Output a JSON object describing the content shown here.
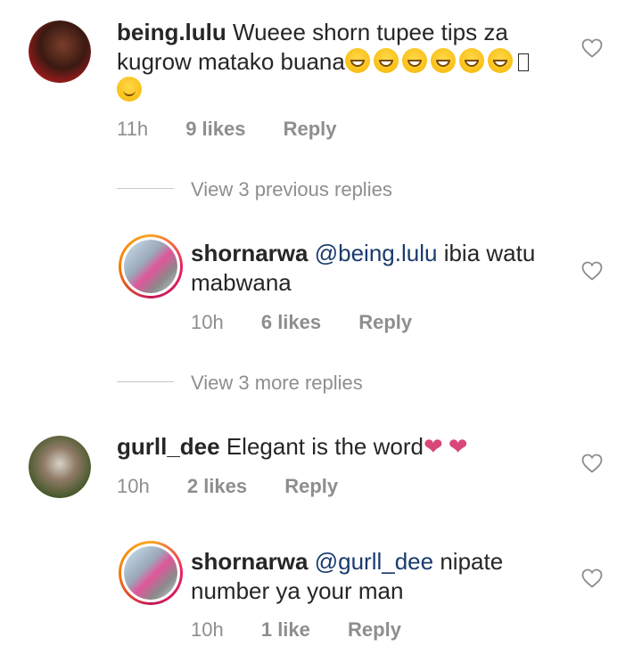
{
  "comments": [
    {
      "username": "being.lulu",
      "text": "Wueee shorn tupee tips za kugrow matako buana",
      "time": "11h",
      "likes": "9 likes",
      "reply": "Reply",
      "avatar_icon": "avatar-photo"
    },
    {
      "username": "shornarwa",
      "mention": "@being.lulu",
      "text": "ibia watu mabwana",
      "time": "10h",
      "likes": "6 likes",
      "reply": "Reply",
      "avatar_icon": "avatar-photo"
    },
    {
      "username": "gurll_dee",
      "text": "Elegant is the word",
      "time": "10h",
      "likes": "2 likes",
      "reply": "Reply",
      "avatar_icon": "avatar-photo"
    },
    {
      "username": "shornarwa",
      "mention": "@gurll_dee",
      "text": "nipate number ya your man",
      "time": "10h",
      "likes": "1 like",
      "reply": "Reply",
      "avatar_icon": "avatar-photo"
    }
  ],
  "threads": {
    "previous_replies": "View 3 previous replies",
    "more_replies": "View 3 more replies"
  },
  "colors": {
    "mention": "#1a3b6d",
    "muted": "#8e8e8e",
    "text": "#262626"
  }
}
